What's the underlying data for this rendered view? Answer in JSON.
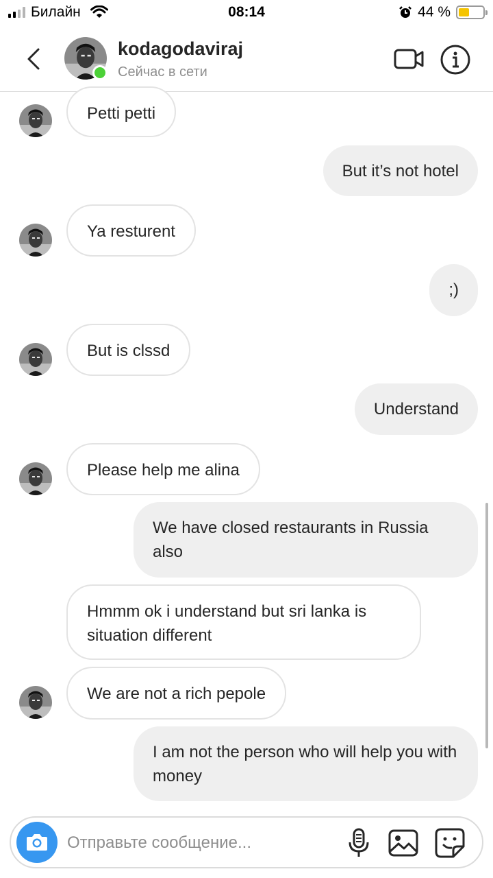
{
  "status_bar": {
    "carrier": "Билайн",
    "time": "08:14",
    "battery_text": "44 %",
    "battery_level": 0.44,
    "icons": [
      "signal-icon",
      "wifi-icon",
      "alarm-icon",
      "battery-icon"
    ]
  },
  "header": {
    "username": "kodagodaviraj",
    "presence": "Сейчас в сети",
    "online_color": "#4cd137",
    "icons": [
      "back-arrow-icon",
      "video-call-icon",
      "info-icon"
    ]
  },
  "messages": [
    {
      "direction": "in",
      "text": "Petti petti",
      "avatar": true
    },
    {
      "direction": "out",
      "text": "But it’s not hotel"
    },
    {
      "direction": "in",
      "text": "Ya resturent",
      "avatar": true
    },
    {
      "direction": "out",
      "text": ";)"
    },
    {
      "direction": "in",
      "text": "But is clssd",
      "avatar": true
    },
    {
      "direction": "out",
      "text": "Understand"
    },
    {
      "direction": "in",
      "text": "Please help me alina",
      "avatar": true
    },
    {
      "direction": "out",
      "text": "We have closed restaurants in Russia also"
    },
    {
      "direction": "in",
      "text": "Hmmm ok i understand but sri lanka is situation different",
      "avatar": false
    },
    {
      "direction": "in",
      "text": "We are not a rich pepole",
      "avatar": true
    },
    {
      "direction": "out",
      "text": "I am not the person who will help you with money"
    }
  ],
  "composer": {
    "placeholder": "Отправьте сообщение...",
    "value": "",
    "accent_color": "#3797f0",
    "icons": [
      "camera-icon",
      "microphone-icon",
      "gallery-icon",
      "sticker-icon"
    ]
  }
}
